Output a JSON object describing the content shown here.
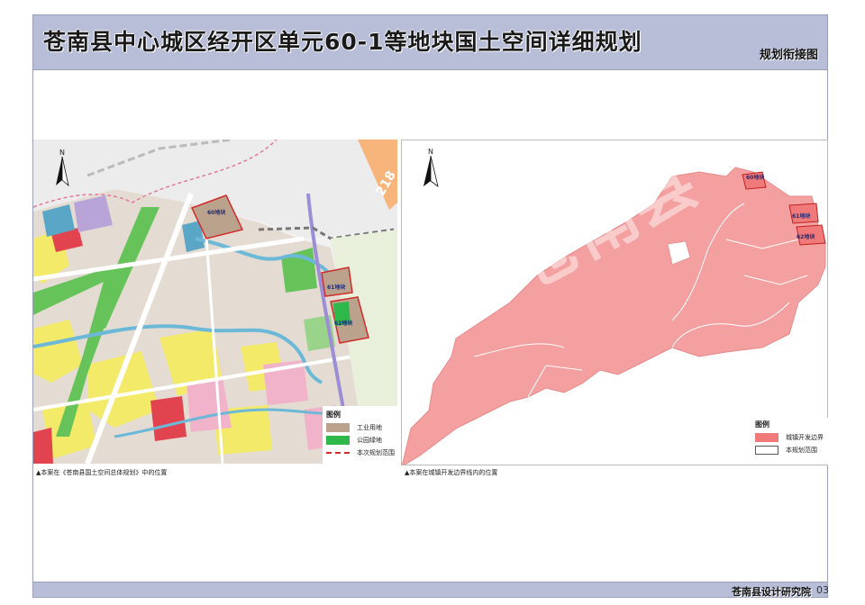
{
  "header": {
    "title": "苍南县中心城区经开区单元60-1等地块国土空间详细规划",
    "subtitle": "规划衔接图"
  },
  "left_map": {
    "north_label": "N",
    "road_number": "218",
    "blocks": [
      {
        "label": "60地块"
      },
      {
        "label": "61地块"
      },
      {
        "label": "62地块"
      }
    ],
    "legend": {
      "title": "图例",
      "items": [
        {
          "label": "工业用地",
          "color": "#bba28c"
        },
        {
          "label": "公园绿地",
          "color": "#2fb84a"
        },
        {
          "label": "本次规划范围",
          "color": "#d12b2b"
        }
      ]
    },
    "caption": "▲本案在《苍南县国土空间总体规划》中的位置"
  },
  "right_map": {
    "north_label": "N",
    "watermark": "苍南县",
    "blocks": [
      {
        "label": "60地块"
      },
      {
        "label": "61地块"
      },
      {
        "label": "62地块"
      }
    ],
    "legend": {
      "title": "图例",
      "items": [
        {
          "label": "城镇开发边界",
          "color": "#f07a7a"
        },
        {
          "label": "本规划范围",
          "color": "#ffffff"
        }
      ]
    },
    "caption": "▲本案在城镇开发边界线内的位置"
  },
  "footer": {
    "org": "苍南县设计研究院",
    "page": "03"
  }
}
